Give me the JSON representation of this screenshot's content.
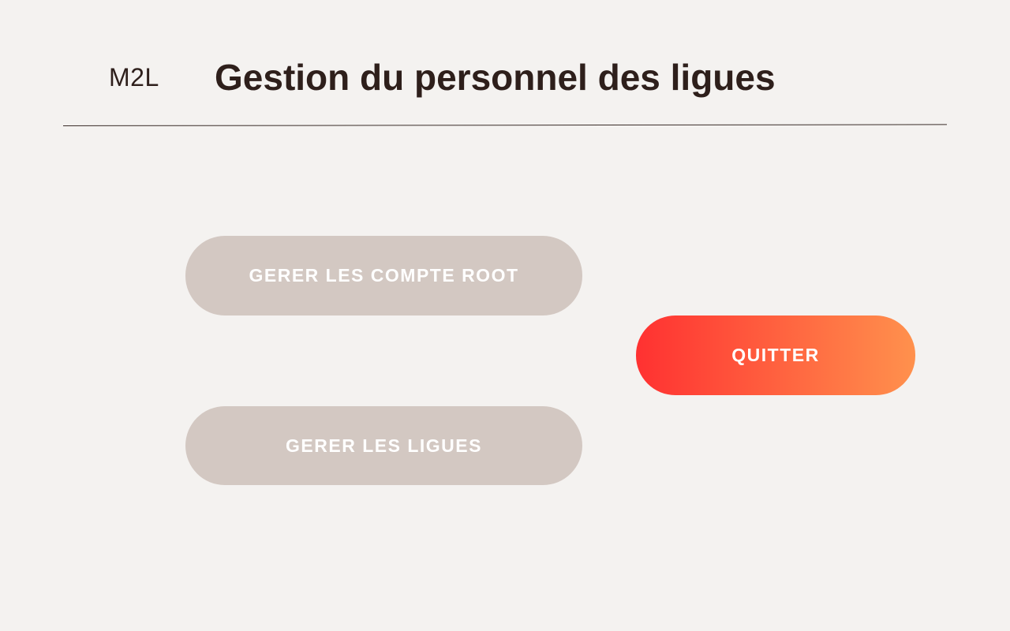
{
  "header": {
    "logo": "M2L",
    "title": "Gestion du personnel des ligues"
  },
  "actions": {
    "manage_root_accounts": "GERER LES COMPTE ROOT",
    "manage_leagues": "GERER LES LIGUES",
    "quit": "QUITTER"
  },
  "colors": {
    "background": "#f4f2f0",
    "text": "#2e1f1b",
    "secondary_button": "#d3c8c2",
    "quit_gradient_start": "#ff3131",
    "quit_gradient_end": "#ff914d"
  }
}
